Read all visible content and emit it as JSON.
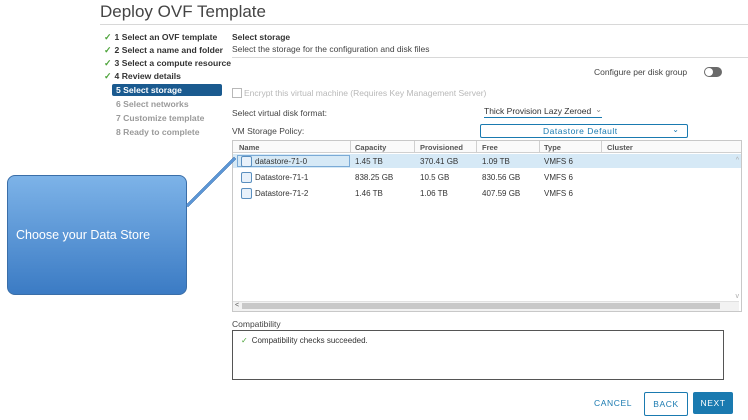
{
  "window": {
    "title": "Deploy OVF Template"
  },
  "steps": [
    {
      "label": "1 Select an OVF template",
      "state": "done"
    },
    {
      "label": "2 Select a name and folder",
      "state": "done"
    },
    {
      "label": "3 Select a compute resource",
      "state": "done"
    },
    {
      "label": "4 Review details",
      "state": "done"
    },
    {
      "label": "5 Select storage",
      "state": "active"
    },
    {
      "label": "6 Select networks",
      "state": "pending"
    },
    {
      "label": "7 Customize template",
      "state": "pending"
    },
    {
      "label": "8 Ready to complete",
      "state": "pending"
    }
  ],
  "page": {
    "heading": "Select storage",
    "subtitle": "Select the storage for the configuration and disk files",
    "per_disk_group_label": "Configure per disk group",
    "encrypt_label": "Encrypt this virtual machine (Requires Key Management Server)"
  },
  "format": {
    "label": "Select virtual disk format:",
    "value": "Thick Provision Lazy Zeroed"
  },
  "policy": {
    "label": "VM Storage Policy:",
    "value": "Datastore Default"
  },
  "table": {
    "headers": [
      "Name",
      "Capacity",
      "Provisioned",
      "Free",
      "Type",
      "Cluster"
    ],
    "rows": [
      {
        "name": "datastore-71-0",
        "capacity": "1.45 TB",
        "provisioned": "370.41 GB",
        "free": "1.09 TB",
        "type": "VMFS 6",
        "cluster": ""
      },
      {
        "name": "Datastore-71-1",
        "capacity": "838.25 GB",
        "provisioned": "10.5 GB",
        "free": "830.56 GB",
        "type": "VMFS 6",
        "cluster": ""
      },
      {
        "name": "Datastore-71-2",
        "capacity": "1.46 TB",
        "provisioned": "1.06 TB",
        "free": "407.59 GB",
        "type": "VMFS 6",
        "cluster": ""
      }
    ]
  },
  "compatibility": {
    "label": "Compatibility",
    "message": "Compatibility checks succeeded."
  },
  "buttons": {
    "cancel": "CANCEL",
    "back": "BACK",
    "next": "NEXT"
  },
  "callout": {
    "text": "Choose your Data Store"
  },
  "icons": {
    "check": "✓",
    "chevron": "⌄",
    "scroll_left": "<",
    "scroll_up": "^",
    "scroll_down": "v"
  },
  "colors": {
    "accent": "#1a7ab0",
    "active_step": "#1a5a8f",
    "check": "#4ca339",
    "callout": "#5b96d6"
  }
}
